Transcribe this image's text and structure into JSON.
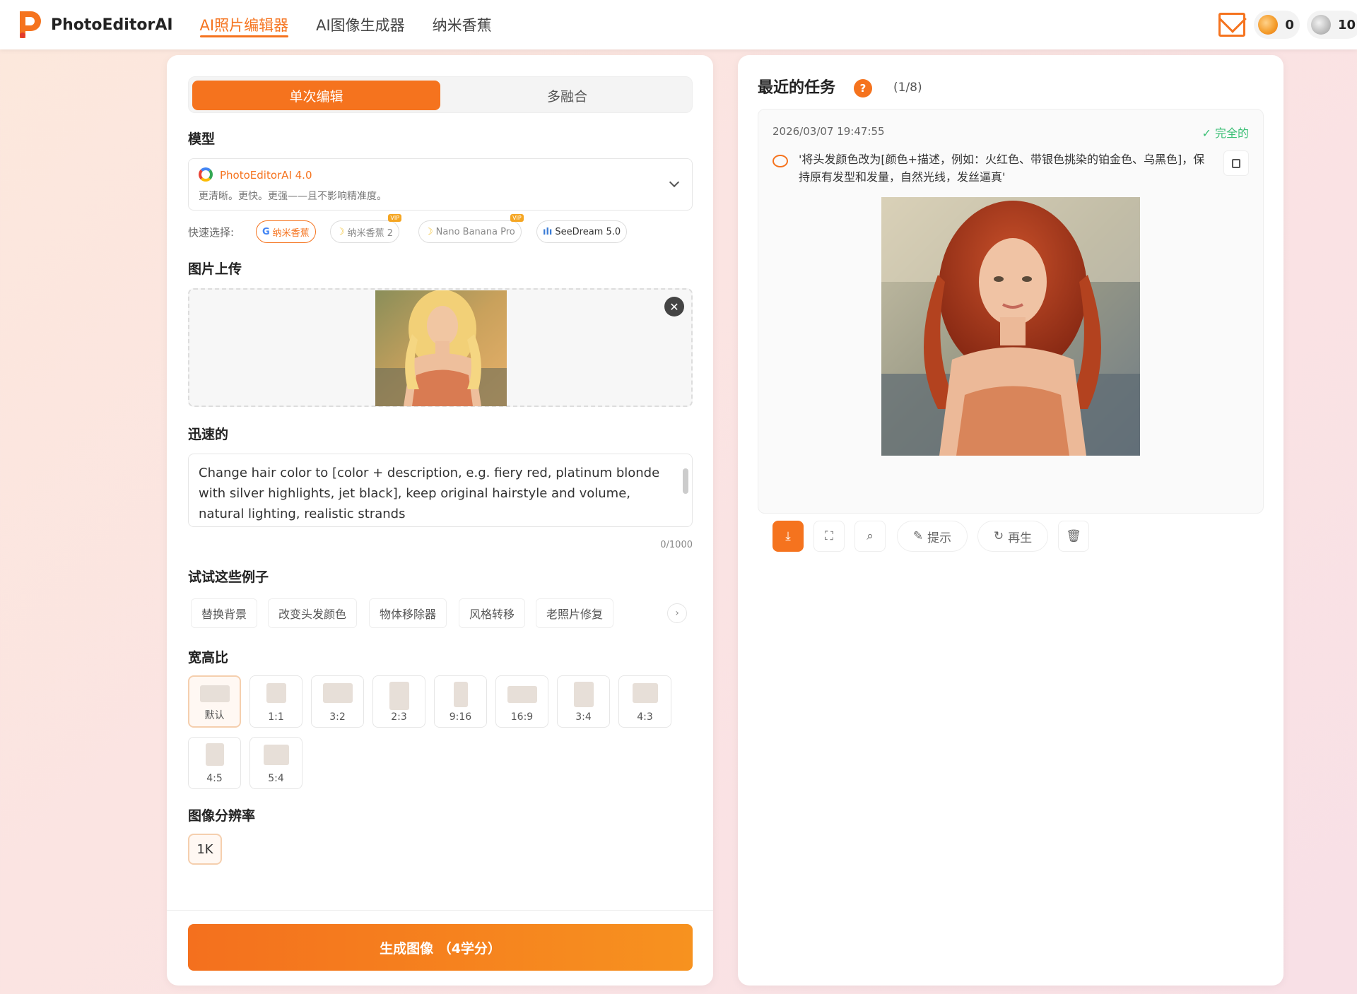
{
  "header": {
    "brand": "PhotoEditorAI",
    "nav": [
      "AI照片编辑器",
      "AI图像生成器",
      "纳米香蕉"
    ],
    "credits_gold": "0",
    "credits_silver": "10"
  },
  "left": {
    "tabs": [
      "单次编辑",
      "多融合"
    ],
    "model_title": "模型",
    "model_name": "PhotoEditorAI 4.0",
    "model_desc": "更清晰。更快。更强——且不影响精准度。",
    "quick_label": "快速选择:",
    "quick_chips": [
      "纳米香蕉",
      "纳米香蕉 2",
      "Nano Banana Pro",
      "SeeDream 5.0"
    ],
    "vip_label": "VIP",
    "upload_title": "图片上传",
    "prompt_title": "迅速的",
    "prompt_text": "Change hair color to [color + description, e.g. fiery red, platinum blonde with silver highlights, jet black], keep original hairstyle and volume, natural lighting, realistic strands",
    "counter": "0/1000",
    "examples_title": "试试这些例子",
    "examples": [
      "替换背景",
      "改变头发颜色",
      "物体移除器",
      "风格转移",
      "老照片修复"
    ],
    "aspect_title": "宽高比",
    "aspects": [
      "默认",
      "1:1",
      "3:2",
      "2:3",
      "9:16",
      "16:9",
      "3:4",
      "4:3",
      "4:5",
      "5:4"
    ],
    "resolution_title": "图像分辨率",
    "resolution": "1K",
    "generate": "生成图像 （4学分）"
  },
  "right": {
    "title": "最近的任务",
    "count": "(1/8)",
    "timestamp": "2026/03/07 19:47:55",
    "status": "✓ 完全的",
    "message": "'将头发颜色改为[颜色+描述，例如：火红色、带银色挑染的铂金色、乌黑色]，保持原有发型和发量，自然光线，发丝逼真'",
    "actions": [
      "提示",
      "再生"
    ]
  },
  "colors": {
    "accent": "#f5731e",
    "success": "#3bbf75"
  }
}
